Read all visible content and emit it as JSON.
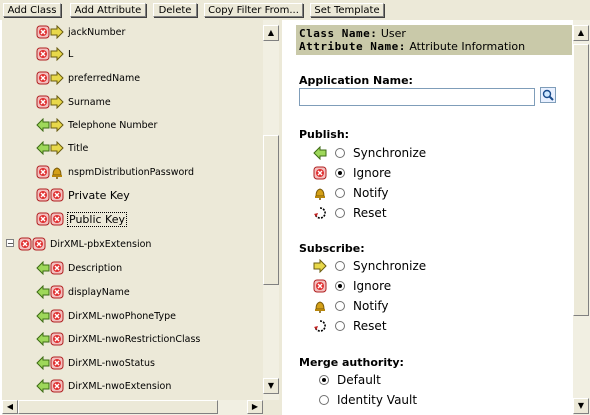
{
  "toolbar": {
    "add_class": "Add Class",
    "add_attribute": "Add Attribute",
    "delete": "Delete",
    "copy_filter": "Copy Filter From...",
    "set_template": "Set Template"
  },
  "tree": {
    "items": [
      {
        "label": "jackNumber",
        "icon": "ignore-sync-icon"
      },
      {
        "label": "L",
        "icon": "ignore-sync-icon"
      },
      {
        "label": "preferredName",
        "icon": "ignore-sync-icon"
      },
      {
        "label": "Surname",
        "icon": "ignore-sync-icon"
      },
      {
        "label": "Telephone Number",
        "icon": "sync-sync-icon"
      },
      {
        "label": "Title",
        "icon": "sync-sync-icon"
      },
      {
        "label": "nspmDistributionPassword",
        "icon": "ignore-notify-icon"
      },
      {
        "label": "Private Key",
        "icon": "ignore-ignore-icon"
      },
      {
        "label": "Public Key",
        "icon": "ignore-ignore-icon"
      },
      {
        "label": "DirXML-pbxExtension",
        "icon": "ignore-ignore-class-icon"
      },
      {
        "label": "Description",
        "icon": "sync-ignore-icon"
      },
      {
        "label": "displayName",
        "icon": "sync-ignore-icon"
      },
      {
        "label": "DirXML-nwoPhoneType",
        "icon": "sync-ignore-icon"
      },
      {
        "label": "DirXML-nwoRestrictionClass",
        "icon": "sync-ignore-icon"
      },
      {
        "label": "DirXML-nwoStatus",
        "icon": "sync-ignore-icon"
      },
      {
        "label": "DirXML-nwoExtension",
        "icon": "sync-ignore-icon"
      }
    ]
  },
  "details": {
    "class_name_key": "Class Name:",
    "class_name_value": "User",
    "attribute_name_key": "Attribute Name:",
    "attribute_name_value": "Attribute Information",
    "application_name_label": "Application Name:",
    "application_name_value": "",
    "publish_label": "Publish:",
    "publish_options": [
      {
        "label": "Synchronize",
        "selected": false
      },
      {
        "label": "Ignore",
        "selected": true
      },
      {
        "label": "Notify",
        "selected": false
      },
      {
        "label": "Reset",
        "selected": false
      }
    ],
    "subscribe_label": "Subscribe:",
    "subscribe_options": [
      {
        "label": "Synchronize",
        "selected": false
      },
      {
        "label": "Ignore",
        "selected": true
      },
      {
        "label": "Notify",
        "selected": false
      },
      {
        "label": "Reset",
        "selected": false
      }
    ],
    "merge_label": "Merge authority:",
    "merge_options": [
      {
        "label": "Default",
        "selected": true
      },
      {
        "label": "Identity Vault",
        "selected": false
      }
    ]
  },
  "colors": {
    "panel_bg": "#ece9d8",
    "header_bg": "#c9c9a9",
    "sync_green": "#8fd14f",
    "ignore_red": "#e03030",
    "notify_gold": "#d4a017"
  }
}
